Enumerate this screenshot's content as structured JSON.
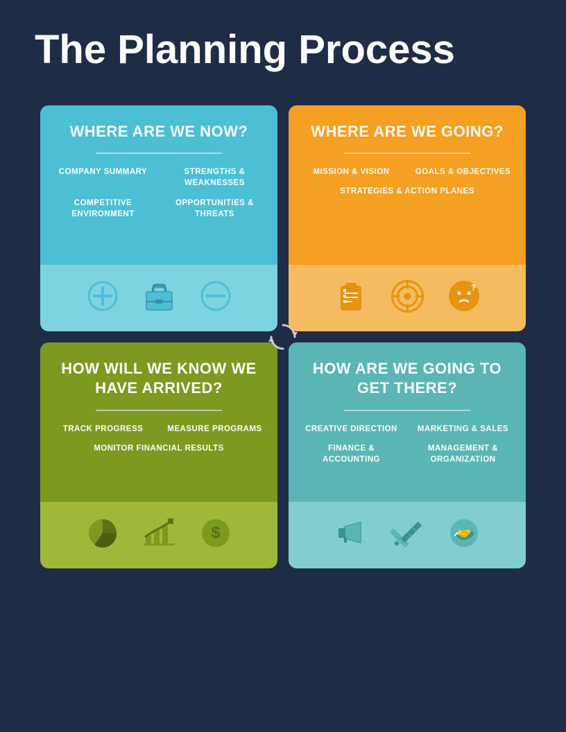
{
  "page": {
    "title": "The Planning Process",
    "background_color": "#1e2d45"
  },
  "cards": [
    {
      "id": "card-1",
      "question": "WHERE ARE WE NOW?",
      "color_top": "#4dbfd4",
      "color_bottom": "#7dd4e0",
      "items": [
        {
          "text": "COMPANY SUMMARY",
          "full": false
        },
        {
          "text": "STRENGTHS & WEAKNESSES",
          "full": false
        },
        {
          "text": "COMPETITIVE ENVIRONMENT",
          "full": false
        },
        {
          "text": "OPPORTUNITIES & THREATS",
          "full": false
        }
      ],
      "icons": [
        "plus-icon",
        "briefcase-icon",
        "minus-icon"
      ]
    },
    {
      "id": "card-2",
      "question": "WHERE ARE WE GOING?",
      "color_top": "#f5a023",
      "color_bottom": "#f5bb60",
      "items": [
        {
          "text": "MISSION & VISION",
          "full": false
        },
        {
          "text": "GOALS & OBJECTIVES",
          "full": false
        },
        {
          "text": "STRATEGIES & ACTION PLANES",
          "full": true
        }
      ],
      "icons": [
        "clipboard-icon",
        "target-icon",
        "question-icon"
      ]
    },
    {
      "id": "card-3",
      "question": "HOW WILL WE KNOW WE HAVE ARRIVED?",
      "color_top": "#7d9a20",
      "color_bottom": "#a0b83a",
      "items": [
        {
          "text": "TRACK PROGRESS",
          "full": false
        },
        {
          "text": "MEASURE PROGRAMS",
          "full": false
        },
        {
          "text": "MONITOR FINANCIAL RESULTS",
          "full": true
        }
      ],
      "icons": [
        "pie-chart-icon",
        "bar-chart-icon",
        "money-icon"
      ]
    },
    {
      "id": "card-4",
      "question": "HOW ARE WE GOING TO GET THERE?",
      "color_top": "#5ab5b5",
      "color_bottom": "#82cece",
      "items": [
        {
          "text": "CREATIVE DIRECTION",
          "full": false
        },
        {
          "text": "MARKETING & SALES",
          "full": false
        },
        {
          "text": "FINANCE & ACCOUNTING",
          "full": false
        },
        {
          "text": "MANAGEMENT & ORGANIZATION",
          "full": false
        }
      ],
      "icons": [
        "megaphone-icon",
        "tools-icon",
        "handshake-icon"
      ]
    }
  ],
  "center": {
    "icon": "refresh-icon"
  }
}
